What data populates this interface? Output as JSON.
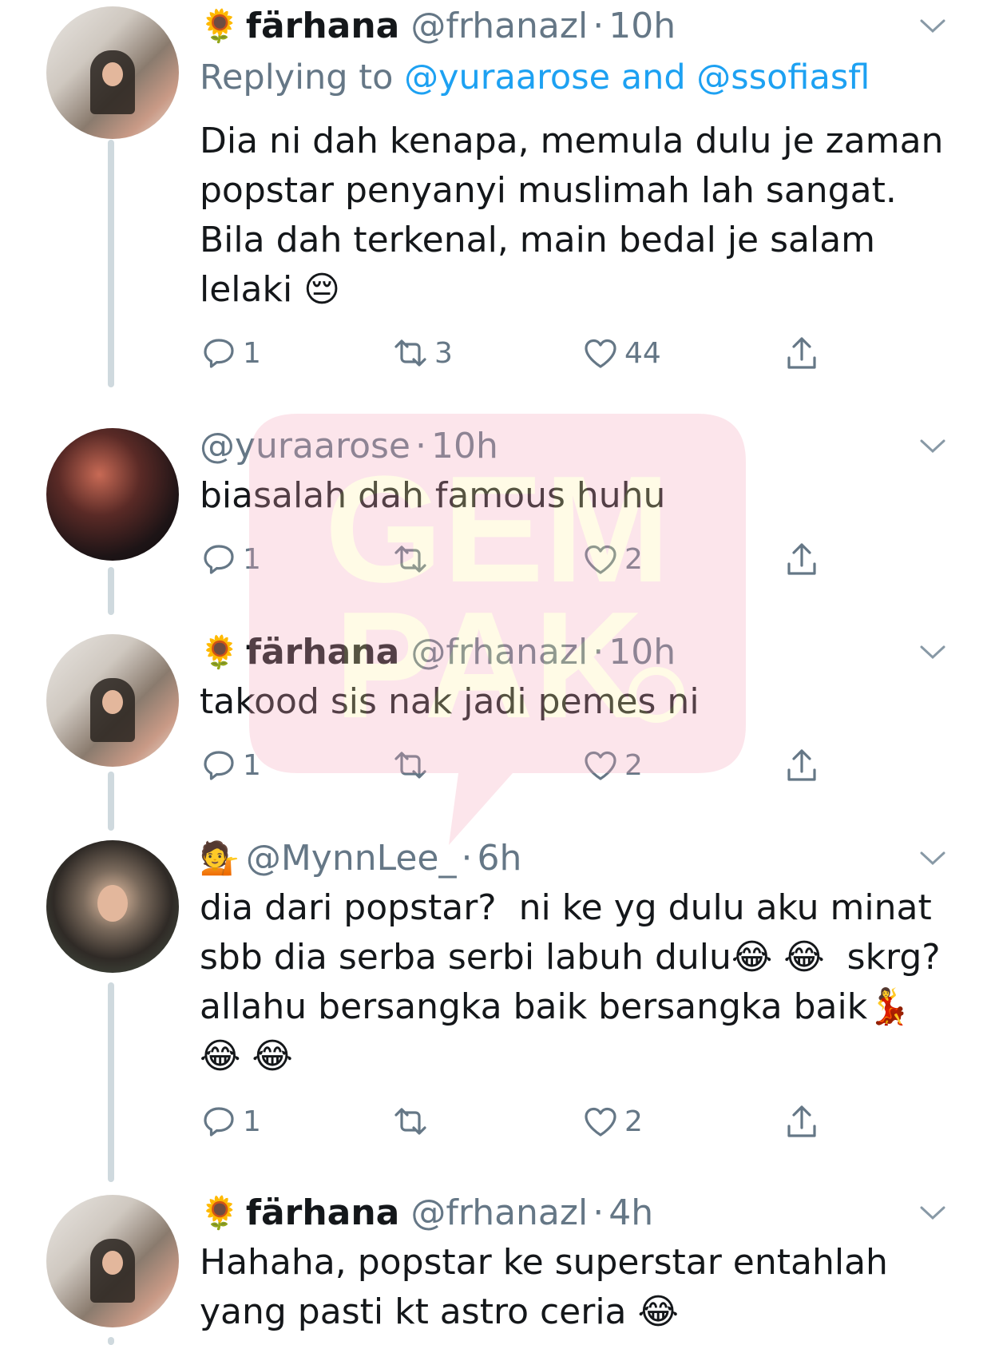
{
  "tweets": [
    {
      "emoji": "🌻",
      "name": "färhana",
      "handle": "@frhanazl",
      "time": "10h",
      "replying_prefix": "Replying to",
      "replying_users": "@yuraarose and @ssofiasfl",
      "text": "Dia ni dah kenapa, memula dulu je zaman popstar penyanyi muslimah lah sangat. Bila dah terkenal, main bedal je salam lelaki 😔",
      "replies": "1",
      "retweets": "3",
      "likes": "44"
    },
    {
      "handle": "@yuraarose",
      "time": "10h",
      "text": "biasalah dah famous huhu",
      "replies": "1",
      "retweets": "",
      "likes": "2"
    },
    {
      "emoji": "🌻",
      "name": "färhana",
      "handle": "@frhanazl",
      "time": "10h",
      "text": "takood sis nak jadi pemes ni",
      "replies": "1",
      "retweets": "",
      "likes": "2"
    },
    {
      "emoji": "💁",
      "handle": "@MynnLee_",
      "time": "6h",
      "text": "dia dari popstar?  ni ke yg dulu aku minat sbb dia serba serbi labuh dulu😂 😂  skrg? allahu bersangka baik bersangka baik💃 😂 😂",
      "replies": "1",
      "retweets": "",
      "likes": "2"
    },
    {
      "emoji": "🌻",
      "name": "färhana",
      "handle": "@frhanazl",
      "time": "4h",
      "text": "Hahaha, popstar ke superstar entahlah yang pasti kt astro ceria 😂"
    }
  ],
  "dot": "·",
  "watermark": {
    "line1": "GEM",
    "line2": "PAK",
    "bubble_color": "#f7a6b8",
    "text_color": "#fff2a8"
  },
  "colors": {
    "accent": "#1da1f2",
    "secondary": "#657786",
    "thread_line": "#cfd9de"
  }
}
